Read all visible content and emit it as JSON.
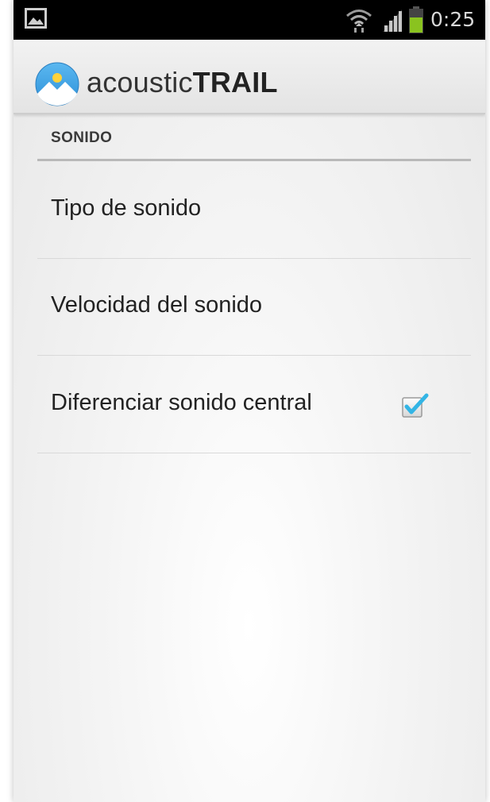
{
  "status_bar": {
    "time": "0:25",
    "icons": [
      "gallery-icon",
      "wifi-icon",
      "signal-icon",
      "battery-icon"
    ],
    "battery_color": "#8ac31f"
  },
  "action_bar": {
    "app_name_light": "acoustic",
    "app_name_bold": "TRAIL",
    "icon": "app-logo-icon"
  },
  "section": {
    "title": "SONIDO"
  },
  "preferences": [
    {
      "label": "Tipo de sonido"
    },
    {
      "label": "Velocidad del sonido"
    },
    {
      "label": "Diferenciar sonido central",
      "checked": true
    }
  ],
  "colors": {
    "checkmark": "#33b5e5",
    "action_bar": "#ececec"
  }
}
